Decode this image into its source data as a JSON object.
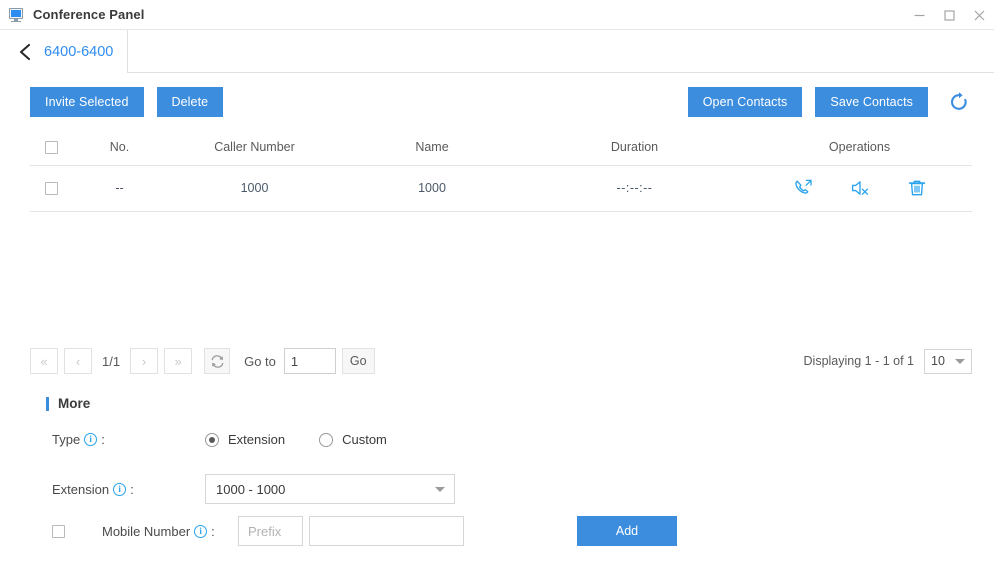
{
  "window": {
    "title": "Conference Panel",
    "app_icon": "monitor-icon",
    "minimize_label": "Minimize",
    "maximize_label": "Maximize",
    "close_label": "Close"
  },
  "breadcrumb": {
    "back_icon": "chevron-left-icon",
    "label": "6400-6400"
  },
  "toolbar": {
    "invite_selected_label": "Invite Selected",
    "delete_label": "Delete",
    "open_contacts_label": "Open Contacts",
    "save_contacts_label": "Save Contacts",
    "refresh_icon": "refresh-icon",
    "accent_color": "#3c8dde"
  },
  "table": {
    "columns": [
      "",
      "No.",
      "Caller Number",
      "Name",
      "Duration",
      "Operations"
    ],
    "rows": [
      {
        "no": "--",
        "caller_number": "1000",
        "name": "1000",
        "duration": "--:--:--",
        "operations": [
          "call-transfer-icon",
          "mute-speaker-icon",
          "delete-trash-icon"
        ]
      }
    ],
    "icon_color": "#29a3ee"
  },
  "pagination": {
    "first_label": "«",
    "prev_label": "‹",
    "page_indicator": "1/1",
    "next_label": "›",
    "last_label": "»",
    "refresh_icon": "refresh-icon",
    "goto_label": "Go to",
    "goto_value": "1",
    "go_label": "Go",
    "displaying": "Displaying 1 - 1 of 1",
    "page_size": "10"
  },
  "more": {
    "section_title": "More",
    "type_label": "Type",
    "type_info_icon": "info-icon",
    "type_options": [
      "Extension",
      "Custom"
    ],
    "type_selected": "Extension",
    "extension_label": "Extension",
    "extension_info_icon": "info-icon",
    "extension_value": "1000 - 1000",
    "mobile_label": "Mobile Number",
    "mobile_info_icon": "info-icon",
    "mobile_checked": false,
    "prefix_placeholder": "Prefix",
    "prefix_value": "",
    "mobile_value": "",
    "add_label": "Add"
  }
}
